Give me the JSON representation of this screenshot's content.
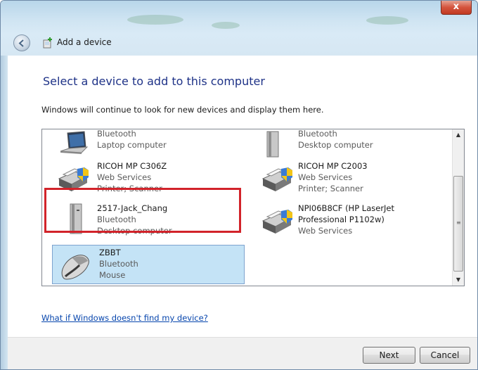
{
  "window": {
    "title": "Add a device",
    "close_glyph": "x"
  },
  "page": {
    "heading": "Select a device to add to this computer",
    "subtitle": "Windows will continue to look for new devices and display them here."
  },
  "devices": [
    {
      "name": "",
      "lines": [
        "Bluetooth",
        "Laptop computer"
      ],
      "icon": "laptop-icon"
    },
    {
      "name": "",
      "lines": [
        "Bluetooth",
        "Desktop computer"
      ],
      "icon": "desktop-tower-icon"
    },
    {
      "name": "RICOH MP C306Z",
      "lines": [
        "Web Services",
        "Printer; Scanner"
      ],
      "icon": "printer-shield-icon"
    },
    {
      "name": "RICOH MP C2003",
      "lines": [
        "Web Services",
        "Printer; Scanner"
      ],
      "icon": "printer-shield-icon"
    },
    {
      "name": "2517-Jack_Chang",
      "lines": [
        "Bluetooth",
        "Desktop computer"
      ],
      "icon": "desktop-tower-icon"
    },
    {
      "name": "NPI06B8CF (HP LaserJet",
      "name2": "Professional P1102w)",
      "lines": [
        "Web Services"
      ],
      "icon": "printer-shield-icon"
    },
    {
      "name": "ZBBT",
      "lines": [
        "Bluetooth",
        "Mouse"
      ],
      "icon": "mouse-icon",
      "selected": true
    }
  ],
  "footer": {
    "help_link": "What if Windows doesn't find my device?",
    "next_label": "Next",
    "cancel_label": "Cancel"
  },
  "colors": {
    "heading": "#1e3287",
    "link": "#0645ad",
    "selection": "#c4e3f6",
    "highlight": "#d2232a"
  }
}
